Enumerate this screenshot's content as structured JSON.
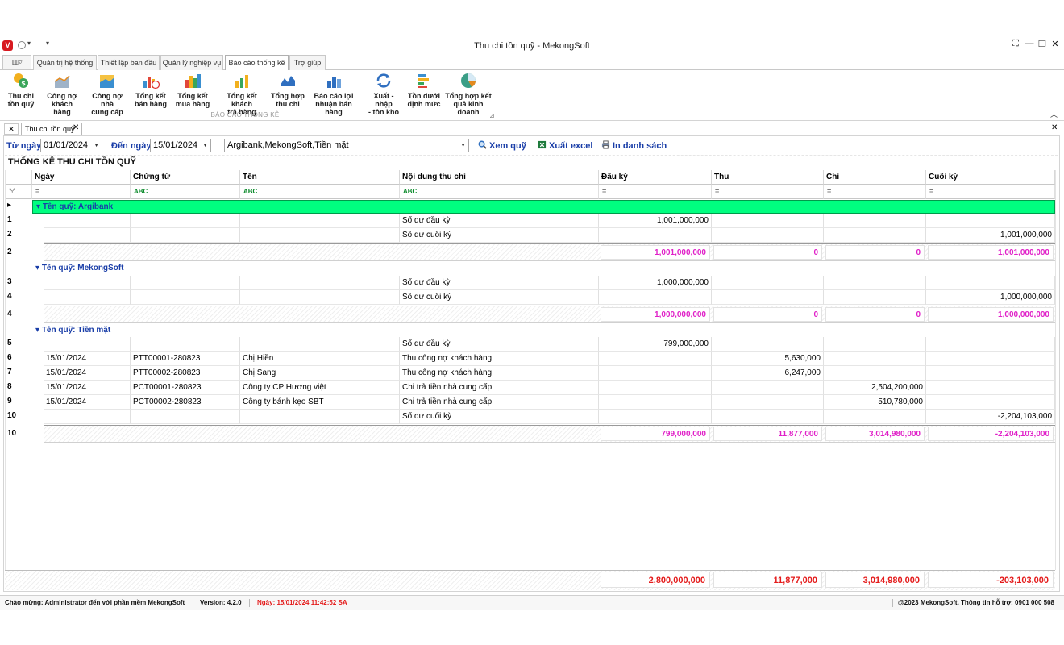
{
  "window": {
    "title": "Thu chi tồn quỹ - MekongSoft",
    "logo_letter": "V"
  },
  "menu_tabs": [
    "Quản trị hệ thống",
    "Thiết lập ban đầu",
    "Quản lý nghiệp vụ",
    "Báo cáo thống kê",
    "Trợ giúp"
  ],
  "ribbon": {
    "group_label": "BÁO CÁO THỐNG KÊ",
    "buttons": [
      {
        "line1": "Thu chi",
        "line2": "tồn quỹ",
        "icon": "coins-icon"
      },
      {
        "line1": "Công nợ",
        "line2": "khách hàng",
        "icon": "area-chart-icon"
      },
      {
        "line1": "Công nợ nhà",
        "line2": "cung cấp",
        "icon": "area-chart-icon"
      },
      {
        "line1": "Tổng kết",
        "line2": "bán hàng",
        "icon": "bar-chart-clock-icon"
      },
      {
        "line1": "Tổng kết",
        "line2": "mua hàng",
        "icon": "bar-chart-icon"
      },
      {
        "line1": "Tổng kết khách",
        "line2": "trả hàng",
        "icon": "bar-chart-icon"
      },
      {
        "line1": "Tổng hợp",
        "line2": "thu chi",
        "icon": "line-chart-icon"
      },
      {
        "line1": "Báo cáo lợi",
        "line2": "nhuận bán hàng",
        "icon": "blue-bar-chart-icon"
      },
      {
        "line1": "Xuất - nhập",
        "line2": "- tồn kho",
        "icon": "refresh-icon"
      },
      {
        "line1": "Tồn dưới",
        "line2": "định mức",
        "icon": "list-chart-icon"
      },
      {
        "line1": "Tổng hợp kết",
        "line2": "quả kinh doanh",
        "icon": "pie-chart-icon"
      }
    ]
  },
  "doc_tab": {
    "label": "Thu chi tồn quỹ"
  },
  "filters": {
    "from_label": "Từ ngày",
    "from_value": "01/01/2024",
    "to_label": "Đến ngày",
    "to_value": "15/01/2024",
    "fund_value": "Argibank,MekongSoft,Tiền mặt",
    "view_button": "Xem quỹ",
    "excel_button": "Xuất excel",
    "print_button": "In danh sách"
  },
  "report_title": "THỐNG KÊ THU CHI TỒN QUỸ",
  "columns": [
    "Ngày",
    "Chứng từ",
    "Tên",
    "Nội dung thu chi",
    "Đầu kỳ",
    "Thu",
    "Chi",
    "Cuối kỳ"
  ],
  "filter_row": {
    "eq": "=",
    "text_op": "ABC"
  },
  "groups": [
    {
      "title": "Tên quỹ: Argibank",
      "rows": [
        {
          "idx": "1",
          "date": "",
          "doc": "",
          "name": "",
          "content": "Số dư đầu kỳ",
          "open": "1,001,000,000",
          "in": "",
          "out": "",
          "close": ""
        },
        {
          "idx": "2",
          "date": "",
          "doc": "",
          "name": "",
          "content": "Số dư cuối kỳ",
          "open": "",
          "in": "",
          "out": "",
          "close": "1,001,000,000"
        }
      ],
      "summary": {
        "idx": "2",
        "open": "1,001,000,000",
        "in": "0",
        "out": "0",
        "close": "1,001,000,000"
      }
    },
    {
      "title": "Tên quỹ: MekongSoft",
      "rows": [
        {
          "idx": "3",
          "date": "",
          "doc": "",
          "name": "",
          "content": "Số dư đầu kỳ",
          "open": "1,000,000,000",
          "in": "",
          "out": "",
          "close": ""
        },
        {
          "idx": "4",
          "date": "",
          "doc": "",
          "name": "",
          "content": "Số dư cuối kỳ",
          "open": "",
          "in": "",
          "out": "",
          "close": "1,000,000,000"
        }
      ],
      "summary": {
        "idx": "4",
        "open": "1,000,000,000",
        "in": "0",
        "out": "0",
        "close": "1,000,000,000"
      }
    },
    {
      "title": "Tên quỹ: Tiền mặt",
      "rows": [
        {
          "idx": "5",
          "date": "",
          "doc": "",
          "name": "",
          "content": "Số dư đầu kỳ",
          "open": "799,000,000",
          "in": "",
          "out": "",
          "close": ""
        },
        {
          "idx": "6",
          "date": "15/01/2024",
          "doc": "PTT00001-280823",
          "name": "Chị Hiền",
          "content": "Thu công nợ khách hàng",
          "open": "",
          "in": "5,630,000",
          "out": "",
          "close": ""
        },
        {
          "idx": "7",
          "date": "15/01/2024",
          "doc": "PTT00002-280823",
          "name": "Chị Sang",
          "content": "Thu công nợ khách hàng",
          "open": "",
          "in": "6,247,000",
          "out": "",
          "close": ""
        },
        {
          "idx": "8",
          "date": "15/01/2024",
          "doc": "PCT00001-280823",
          "name": "Công ty CP Hương việt",
          "content": "Chi trả tiền nhà cung cấp",
          "open": "",
          "in": "",
          "out": "2,504,200,000",
          "close": ""
        },
        {
          "idx": "9",
          "date": "15/01/2024",
          "doc": "PCT00002-280823",
          "name": "Công ty bánh kẹo SBT",
          "content": "Chi trả tiền nhà cung cấp",
          "open": "",
          "in": "",
          "out": "510,780,000",
          "close": ""
        },
        {
          "idx": "10",
          "date": "",
          "doc": "",
          "name": "",
          "content": "Số dư cuối kỳ",
          "open": "",
          "in": "",
          "out": "",
          "close": "-2,204,103,000"
        }
      ],
      "summary": {
        "idx": "10",
        "open": "799,000,000",
        "in": "11,877,000",
        "out": "3,014,980,000",
        "close": "-2,204,103,000"
      }
    }
  ],
  "totals": {
    "open": "2,800,000,000",
    "in": "11,877,000",
    "out": "3,014,980,000",
    "close": "-203,103,000"
  },
  "status": {
    "welcome": "Chào mừng: Administrator đến với phần mềm MekongSoft",
    "version": "Version: 4.2.0",
    "date": "Ngày: 15/01/2024 11:42:52 SA",
    "copyright": "@2023 MekongSoft. Thông tin hỗ trợ: 0901 000 508"
  },
  "colors": {
    "accent": "#1a3ea8",
    "selected_group": "#00ff80",
    "summary": "#e020c8",
    "total": "#e41b1b",
    "status_date": "#e41b1b"
  }
}
